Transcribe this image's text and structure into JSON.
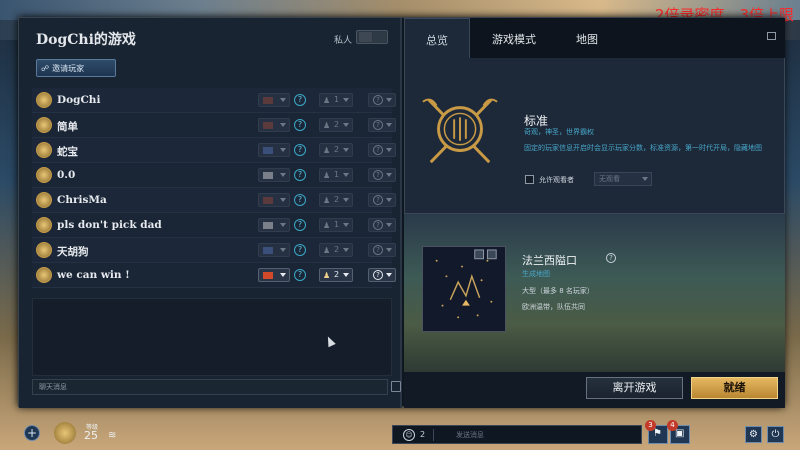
{
  "overlay_text": "2倍录密度，3倍上限",
  "lobby": {
    "title": "DogChi的游戏",
    "private_label": "私人",
    "invite_label": "邀请玩家",
    "players": [
      {
        "name": "DogChi",
        "team": "1",
        "active": false,
        "flag": "dark"
      },
      {
        "name": "简单",
        "team": "2",
        "active": false,
        "flag": "dark"
      },
      {
        "name": "蛇宝",
        "team": "2",
        "active": false,
        "flag": "blue"
      },
      {
        "name": "0.0",
        "team": "1",
        "active": false,
        "flag": "grey"
      },
      {
        "name": "ChrisMa",
        "team": "2",
        "active": false,
        "flag": "dark"
      },
      {
        "name": "pls don't pick dad",
        "team": "1",
        "active": false,
        "flag": "grey"
      },
      {
        "name": "天胡狗",
        "team": "2",
        "active": false,
        "flag": "blue"
      },
      {
        "name": "we can win !",
        "team": "2",
        "active": true,
        "flag": "lit"
      }
    ],
    "chat_placeholder": "聊天消息"
  },
  "tabs": [
    "总览",
    "游戏模式",
    "地图"
  ],
  "mode": {
    "title": "标准",
    "subtitle": "奇观，神圣，世界霸权",
    "description": "固定的玩家信息开启时会显示玩家分数，标准资源，第一时代开局，隐藏地图",
    "spectator_label": "允许观看者",
    "spectator_value": "无观看"
  },
  "map": {
    "title": "法兰西隘口",
    "generator": "生成地图",
    "size": "大型（最多 8 名玩家）",
    "location": "欧洲温带，队伍共同"
  },
  "buttons": {
    "leave": "离开游戏",
    "ready": "就绪"
  },
  "footer": {
    "level_label": "等级",
    "level": "25",
    "social_count": "2",
    "social_placeholder": "发送消息",
    "badge_1": "3",
    "badge_2": "4"
  },
  "colors": {
    "accent_gold": "#e6b862",
    "info_cyan": "#47a6c8",
    "panel": "#192433"
  }
}
